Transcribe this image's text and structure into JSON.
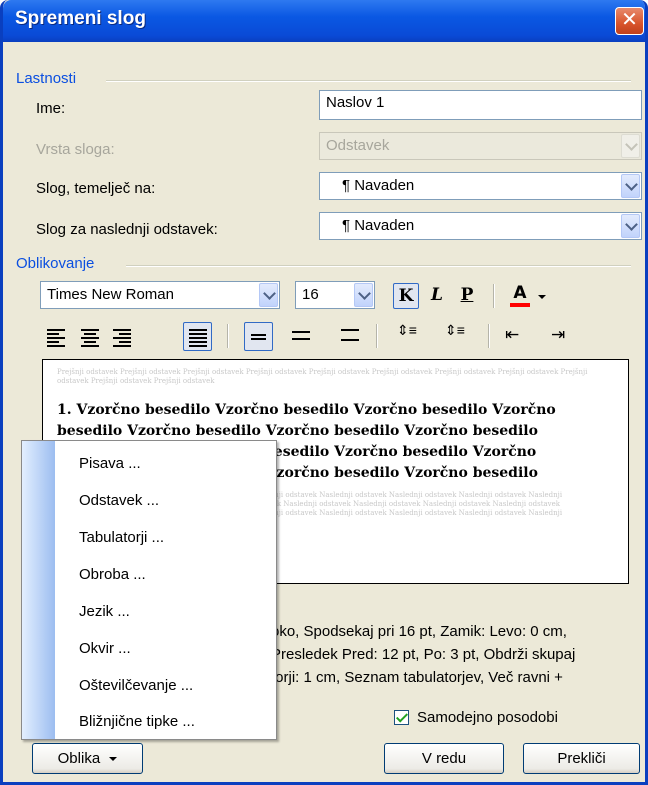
{
  "window": {
    "title": "Spremeni slog",
    "close_glyph": "✕"
  },
  "properties": {
    "section_label": "Lastnosti",
    "name_label": "Ime:",
    "name_value": "Naslov 1",
    "type_label": "Vrsta sloga:",
    "type_value": "Odstavek",
    "based_on_label": "Slog, temelječ na:",
    "based_on_value": "¶ Navaden",
    "next_label": "Slog za naslednji odstavek:",
    "next_value": "¶ Navaden"
  },
  "formatting": {
    "section_label": "Oblikovanje",
    "font": "Times New Roman",
    "size": "16",
    "bold": "K",
    "italic": "L",
    "underline": "P",
    "font_color_glyph": "A",
    "font_color": "#ff0000"
  },
  "preview": {
    "previous_paragraph": "Prejšnji odstavek Prejšnji odstavek Prejšnji odstavek Prejšnji odstavek Prejšnji odstavek Prejšnji odstavek Prejšnji odstavek Prejšnji odstavek Prejšnji odstavek Prejšnji odstavek Prejšnji odstavek",
    "sample_number": "1.",
    "sample_text": "Vzorčno besedilo Vzorčno besedilo Vzorčno besedilo Vzorčno besedilo Vzorčno besedilo Vzorčno besedilo Vzorčno besedilo Vzorčno besedilo Vzorčno besedilo Vzorčno besedilo Vzorčno besedilo Vzorčno besedilo Vzorčno besedilo Vzorčno besedilo",
    "next_paragraph": "Naslednji odstavek Naslednji odstavek Naslednji odstavek Naslednji odstavek Naslednji odstavek Naslednji odstavek Naslednji odstavek Naslednji odstavek Naslednji odstavek Naslednji odstavek Naslednji odstavek Naslednji odstavek Naslednji odstavek Naslednji odstavek Naslednji odstavek Naslednji odstavek Naslednji odstavek Naslednji odstavek Naslednji odstavek Naslednji odstavek Naslednji odstavek"
  },
  "description": {
    "line1": "oko, Spodsekaj pri 16 pt, Zamik: Levo:  0 cm,",
    "line2": "Presledek Pred:  12 pt, Po:  3 pt, Obdrži skupaj",
    "line3": "torji:  1 cm, Seznam tabulatorjev, Več ravni +"
  },
  "auto_update_label": "Samodejno posodobi",
  "buttons": {
    "format": "Oblika",
    "ok": "V redu",
    "cancel": "Prekliči"
  },
  "format_menu": {
    "items": [
      "Pisava ...",
      "Odstavek ...",
      "Tabulatorji ...",
      "Obroba ...",
      "Jezik ...",
      "Okvir ...",
      "Oštevilčevanje ...",
      "Bližnjične tipke ..."
    ]
  }
}
